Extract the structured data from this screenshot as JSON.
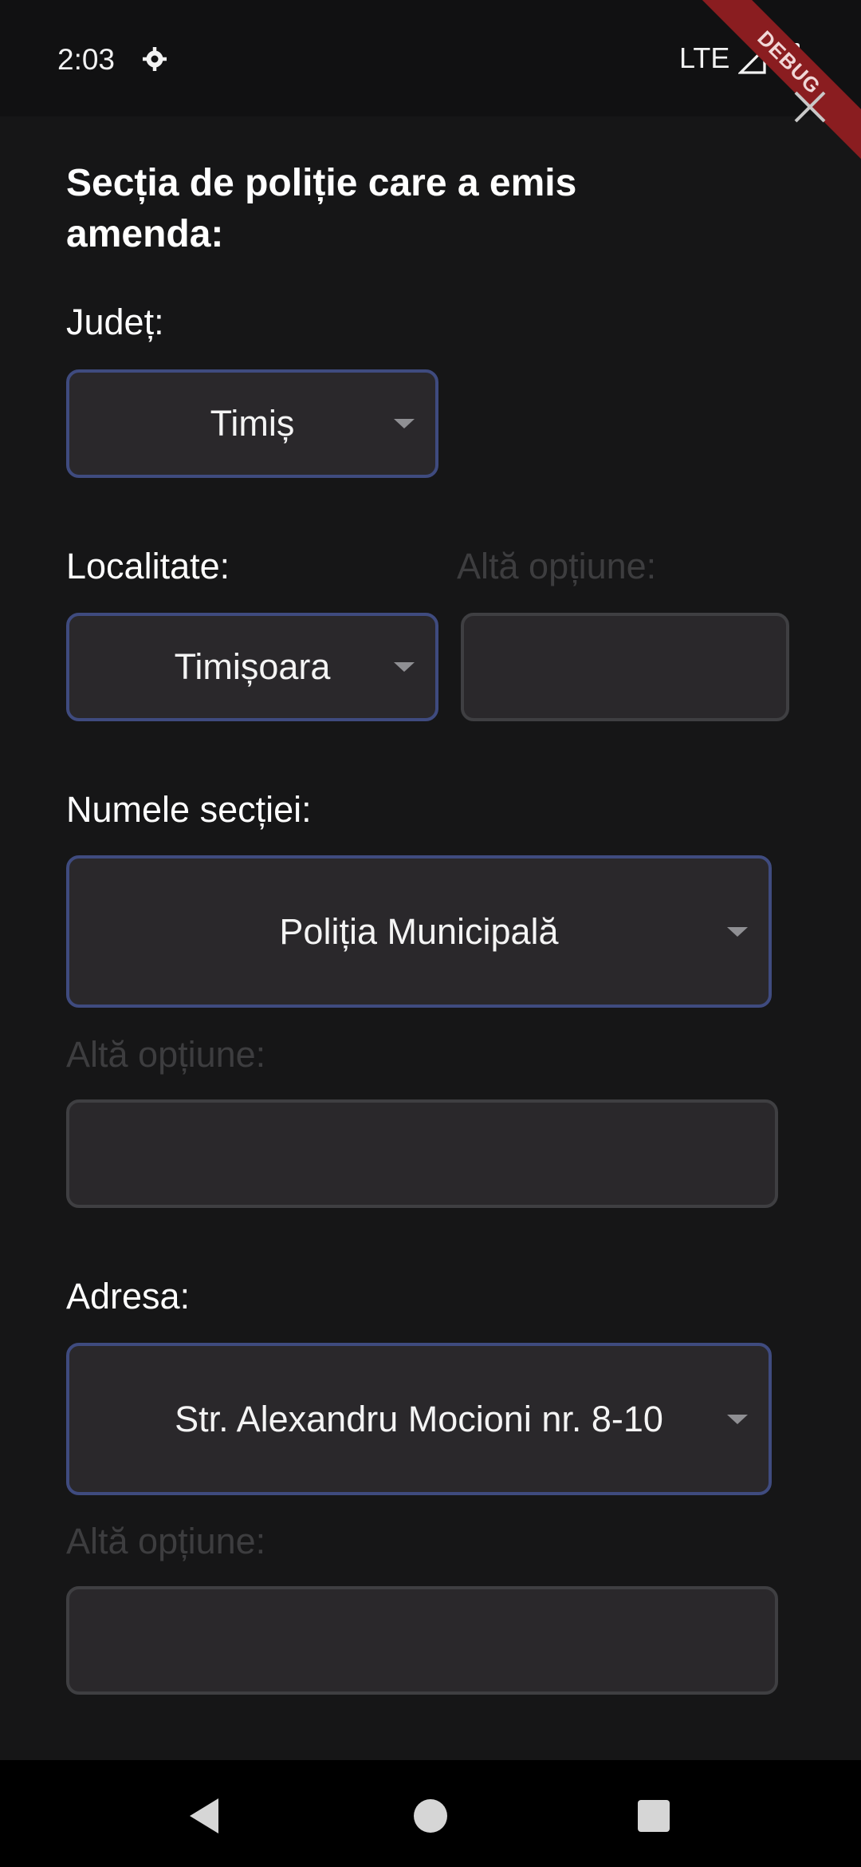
{
  "status_bar": {
    "time": "2:03",
    "network": "LTE",
    "icons": [
      "settings-gear-icon",
      "signal-icon",
      "battery-icon"
    ]
  },
  "debug_banner": "DEBUG",
  "form": {
    "heading": "Secția de poliție care a emis amenda:",
    "judet": {
      "label": "Județ:",
      "value": "Timiș"
    },
    "localitate": {
      "label": "Localitate:",
      "value": "Timișoara"
    },
    "localitate_alt": {
      "label": "Altă opțiune:",
      "value": ""
    },
    "sectie": {
      "label": "Numele secției:",
      "value": "Poliția Municipală"
    },
    "sectie_alt": {
      "label": "Altă opțiune:",
      "value": ""
    },
    "adresa": {
      "label": "Adresa:",
      "value": "Str. Alexandru Mocioni nr. 8-10"
    },
    "adresa_alt": {
      "label": "Altă opțiune:",
      "value": ""
    }
  },
  "colors": {
    "background": "#161617",
    "field_background": "#2a282b",
    "dropdown_border": "#3f4b7f",
    "text_field_border": "#3f3f42",
    "disabled_label": "#3d3d3f",
    "debug_ribbon": "#8a1d20"
  }
}
